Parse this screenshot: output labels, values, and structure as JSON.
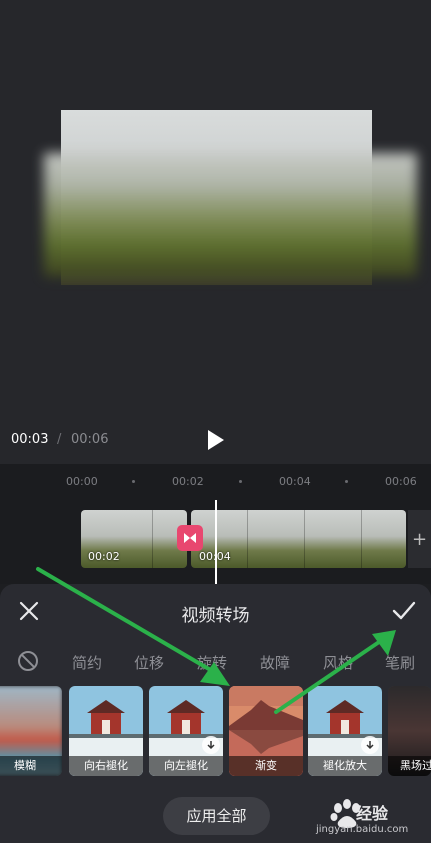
{
  "player": {
    "current_time": "00:03",
    "separator": "/",
    "total_time": "00:06"
  },
  "timeline": {
    "ruler": [
      "00:00",
      "00:02",
      "00:04",
      "00:06"
    ],
    "clips": [
      {
        "start_label": "00:02"
      },
      {
        "start_label": "00:04"
      }
    ],
    "add_label": "+"
  },
  "sheet": {
    "title": "视频转场",
    "categories": [
      "简约",
      "位移",
      "旋转",
      "故障",
      "风格",
      "笔刷"
    ],
    "effects": [
      {
        "label": "模糊",
        "selected": false,
        "download": false,
        "icon": "blur-thumb"
      },
      {
        "label": "向右褪化",
        "selected": false,
        "download": false,
        "icon": "red-house-thumb"
      },
      {
        "label": "向左褪化",
        "selected": false,
        "download": true,
        "icon": "red-house-thumb"
      },
      {
        "label": "渐变",
        "selected": true,
        "download": false,
        "icon": "mountain-lake-thumb"
      },
      {
        "label": "褪化放大",
        "selected": false,
        "download": true,
        "icon": "red-house-thumb"
      },
      {
        "label": "黑场过",
        "selected": false,
        "download": false,
        "icon": "dark-thumb"
      }
    ],
    "apply_all": "应用全部"
  },
  "watermark": {
    "text": "经验",
    "url": "jingyan.baidu.com"
  },
  "colors": {
    "accent": "#e8476f",
    "annotation_arrow": "#2bb14a",
    "sheet_bg": "#2a2b31"
  }
}
